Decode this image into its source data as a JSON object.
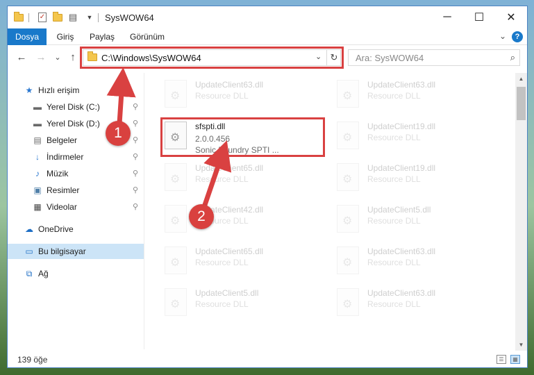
{
  "window": {
    "title": "SysWOW64",
    "controls": {
      "minimize": "─",
      "maximize": "☐",
      "close": "✕"
    }
  },
  "ribbon": {
    "tabs": [
      "Dosya",
      "Giriş",
      "Paylaş",
      "Görünüm"
    ],
    "expand_glyph": "⌄",
    "help_glyph": "?"
  },
  "nav": {
    "back": "←",
    "forward": "→",
    "recent": "⌄",
    "up": "↑",
    "address": "C:\\Windows\\SysWOW64",
    "address_dropdown": "⌄",
    "refresh": "↻",
    "search_placeholder": "Ara: SysWOW64",
    "search_icon": "⌕"
  },
  "sidebar": {
    "items": [
      {
        "label": "Hızlı erişim",
        "icon": "star-icon",
        "glyph": "★",
        "color": "#2b78d0",
        "pinned": false
      },
      {
        "label": "Yerel Disk (C:)",
        "icon": "drive-icon",
        "glyph": "▬",
        "color": "#6a6a6a",
        "pinned": true
      },
      {
        "label": "Yerel Disk (D:)",
        "icon": "drive-icon",
        "glyph": "▬",
        "color": "#6a6a6a",
        "pinned": true
      },
      {
        "label": "Belgeler",
        "icon": "documents-icon",
        "glyph": "▤",
        "color": "#6a6a6a",
        "pinned": true
      },
      {
        "label": "İndirmeler",
        "icon": "download-icon",
        "glyph": "↓",
        "color": "#2b78d0",
        "pinned": true
      },
      {
        "label": "Müzik",
        "icon": "music-icon",
        "glyph": "♪",
        "color": "#2b78d0",
        "pinned": true
      },
      {
        "label": "Resimler",
        "icon": "pictures-icon",
        "glyph": "▣",
        "color": "#4f7fa8",
        "pinned": true
      },
      {
        "label": "Videolar",
        "icon": "video-icon",
        "glyph": "▦",
        "color": "#444444",
        "pinned": true
      },
      {
        "label": "OneDrive",
        "icon": "cloud-icon",
        "glyph": "☁",
        "color": "#1f6fc5",
        "pinned": false
      },
      {
        "label": "Bu bilgisayar",
        "icon": "computer-icon",
        "glyph": "▭",
        "color": "#1f6fc5",
        "pinned": false,
        "selected": true
      },
      {
        "label": "Ağ",
        "icon": "network-icon",
        "glyph": "⧉",
        "color": "#1f6fc5",
        "pinned": false
      }
    ],
    "pin_glyph": "📌"
  },
  "files": [
    {
      "name": "UpdateClient63.dll",
      "type": "Resource DLL",
      "faded": true
    },
    {
      "name": "UpdateClient63.dll",
      "type": "Resource DLL",
      "faded": true
    },
    {
      "name": "sfspti.dll",
      "version": "2.0.0.456",
      "description": "Sonic Foundry SPTI ...",
      "faded": false
    },
    {
      "name": "UpdateClient19.dll",
      "type": "Resource DLL",
      "faded": true
    },
    {
      "name": "UpdateClient65.dll",
      "type": "Resource DLL",
      "faded": true
    },
    {
      "name": "UpdateClient19.dll",
      "type": "Resource DLL",
      "faded": true
    },
    {
      "name": "UpdateClient42.dll",
      "type": "Resource DLL",
      "faded": true
    },
    {
      "name": "UpdateClient5.dll",
      "type": "Resource DLL",
      "faded": true
    },
    {
      "name": "UpdateClient65.dll",
      "type": "Resource DLL",
      "faded": true
    },
    {
      "name": "UpdateClient63.dll",
      "type": "Resource DLL",
      "faded": true
    },
    {
      "name": "UpdateClient5.dll",
      "type": "Resource DLL",
      "faded": true
    },
    {
      "name": "UpdateClient63.dll",
      "type": "Resource DLL",
      "faded": true
    }
  ],
  "status": {
    "item_count": "139 öğe"
  },
  "annotations": {
    "marker1": "1",
    "marker2": "2",
    "accent_color": "#d94141"
  },
  "colors": {
    "ribbon_file_tab": "#1979ca",
    "selection": "#cce4f7"
  }
}
